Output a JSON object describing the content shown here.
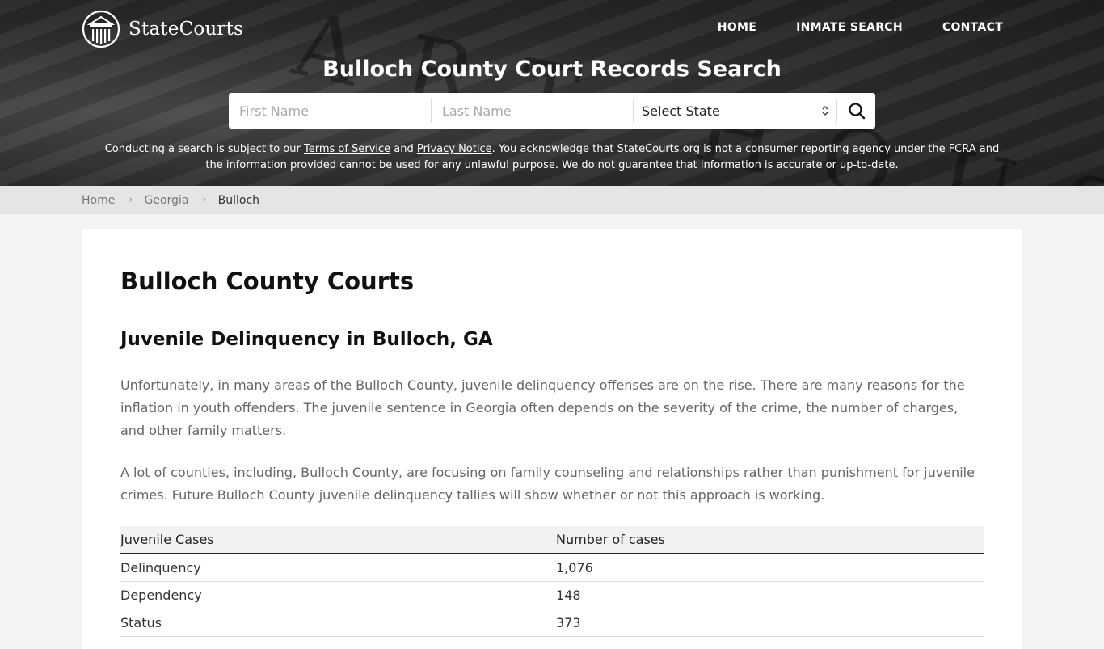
{
  "header": {
    "logo_text": "StateCourts",
    "nav": [
      {
        "label": "HOME"
      },
      {
        "label": "INMATE SEARCH"
      },
      {
        "label": "CONTACT"
      }
    ],
    "title": "Bulloch County Court Records Search",
    "bg_text": "ART HOUSE"
  },
  "search": {
    "first_name_placeholder": "First Name",
    "last_name_placeholder": "Last Name",
    "state_select_value": "Select State",
    "search_icon": "search-icon"
  },
  "disclaimer": {
    "part1": "Conducting a search is subject to our ",
    "terms_link": "Terms of Service",
    "part2": " and ",
    "privacy_link": "Privacy Notice",
    "part3": ". You acknowledge that StateCourts.org is not a consumer reporting agency under the FCRA and the information provided cannot be used for any unlawful purpose. We do not guarantee that information is accurate or up-to-date."
  },
  "breadcrumb": {
    "items": [
      {
        "label": "Home"
      },
      {
        "label": "Georgia"
      }
    ],
    "current": "Bulloch",
    "separator": "›"
  },
  "main": {
    "title": "Bulloch County Courts",
    "section_title": "Juvenile Delinquency in Bulloch, GA",
    "paragraphs": [
      "Unfortunately, in many areas of the Bulloch County, juvenile delinquency offenses are on the rise. There are many reasons for the inflation in youth offenders. The juvenile sentence in Georgia often depends on the severity of the crime, the number of charges, and other family matters.",
      "A lot of counties, including, Bulloch County, are focusing on family counseling and relationships rather than punishment for juvenile crimes. Future Bulloch County juvenile delinquency tallies will show whether or not this approach is working."
    ],
    "table": {
      "headers": [
        "Juvenile Cases",
        "Number of cases"
      ],
      "rows": [
        [
          "Delinquency",
          "1,076"
        ],
        [
          "Dependency",
          "148"
        ],
        [
          "Status",
          "373"
        ]
      ]
    }
  }
}
